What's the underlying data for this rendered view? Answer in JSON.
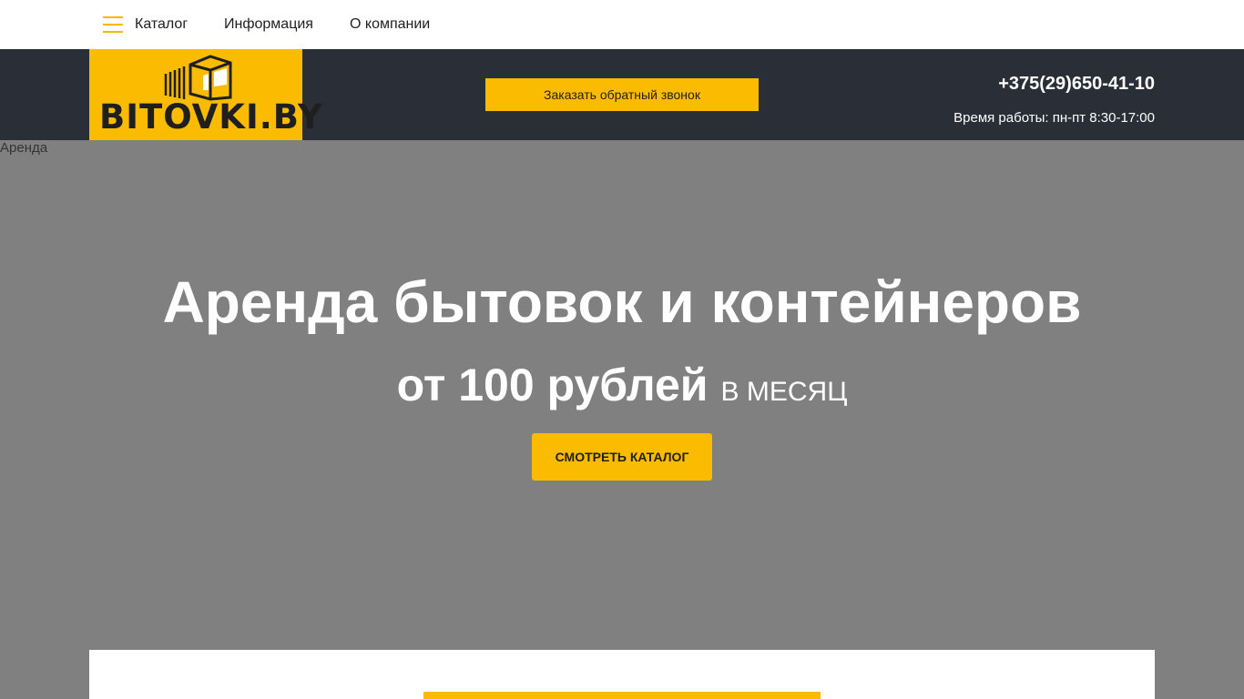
{
  "topnav": {
    "menu_icon": "hamburger-icon",
    "links": [
      {
        "label": "Каталог"
      },
      {
        "label": "Информация"
      },
      {
        "label": "О компании"
      }
    ]
  },
  "header": {
    "logo_text": "BITOVKI.BY",
    "logo_icon": "building-container-icon",
    "callback_label": "Заказать обратный звонок",
    "phone": "+375(29)650-41-10",
    "hours": "Время работы: пн-пт 8:30-17:00"
  },
  "hero": {
    "image_alt": "Аренда",
    "title": "Аренда бытовок и контейнеров",
    "price": "от 100 рублей",
    "unit": "В МЕСЯЦ",
    "button_label": "СМОТРЕТЬ КАТАЛОГ"
  },
  "colors": {
    "accent": "#fbbb00",
    "header_bg": "#2a2e36",
    "hero_bg": "#808080"
  }
}
